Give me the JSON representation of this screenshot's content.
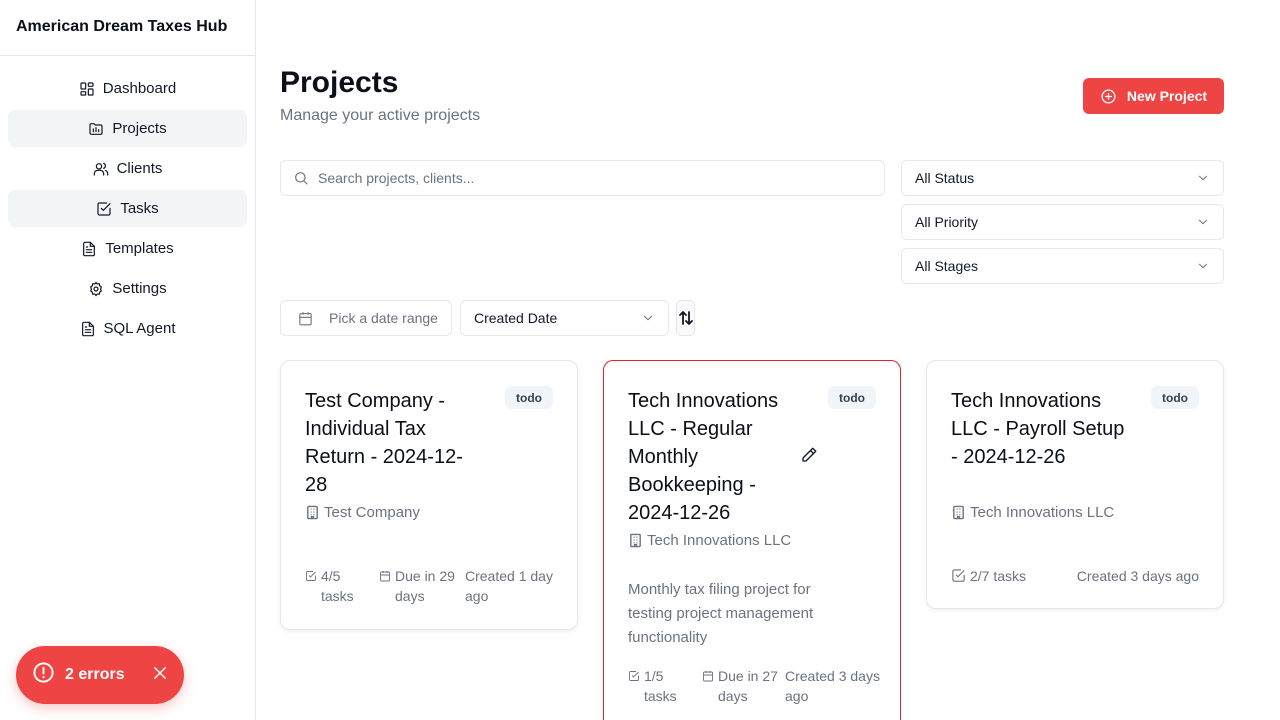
{
  "app": {
    "brand": "American Dream Taxes Hub"
  },
  "sidebar": {
    "items": [
      {
        "label": "Dashboard",
        "icon": "dashboard-icon"
      },
      {
        "label": "Projects",
        "icon": "projects-icon"
      },
      {
        "label": "Clients",
        "icon": "users-icon"
      },
      {
        "label": "Tasks",
        "icon": "check-square-icon"
      },
      {
        "label": "Templates",
        "icon": "file-icon"
      },
      {
        "label": "Settings",
        "icon": "gear-icon"
      },
      {
        "label": "SQL Agent",
        "icon": "file-icon"
      }
    ]
  },
  "header": {
    "title": "Projects",
    "subtitle": "Manage your active projects",
    "new_button": "New Project"
  },
  "filters": {
    "search_placeholder": "Search projects, clients...",
    "status": "All Status",
    "priority": "All Priority",
    "stages": "All Stages",
    "date_range_placeholder": "Pick a date range",
    "sort_field": "Created Date"
  },
  "projects": [
    {
      "title": "Test Company - Individual Tax Return - 2024-12-28",
      "status": "todo",
      "client": "Test Company",
      "description": "",
      "tasks": "4/5 tasks",
      "due": "Due in 29 days",
      "created": "Created 1 day ago"
    },
    {
      "title": "Tech Innovations LLC - Regular Monthly Bookkeeping - 2024-12-26",
      "status": "todo",
      "client": "Tech Innovations LLC",
      "description": "Monthly tax filing project for testing project management functionality",
      "tasks": "1/5 tasks",
      "due": "Due in 27 days",
      "created": "Created 3 days ago"
    },
    {
      "title": "Tech Innovations LLC - Payroll Setup - 2024-12-26",
      "status": "todo",
      "client": "Tech Innovations LLC",
      "description": "",
      "tasks": "2/7 tasks",
      "due": "",
      "created": "Created 3 days ago"
    }
  ],
  "toast": {
    "label": "2 errors"
  },
  "colors": {
    "accent": "#ef4444",
    "border": "#e5e7eb",
    "muted": "#6b7280"
  }
}
